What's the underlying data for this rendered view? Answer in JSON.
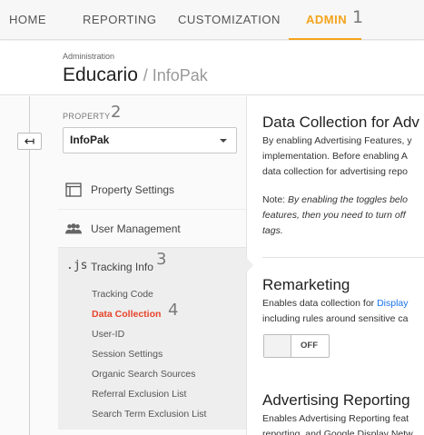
{
  "topnav": {
    "tabs": [
      {
        "label": "HOME"
      },
      {
        "label": "REPORTING"
      },
      {
        "label": "CUSTOMIZATION"
      },
      {
        "label": "ADMIN",
        "active": true
      }
    ],
    "active_color": "#f4a31b"
  },
  "annotations": [
    "1",
    "2",
    "3",
    "4"
  ],
  "header": {
    "breadcrumb": "Administration",
    "account": "Educario",
    "property_suffix": "/ InfoPak"
  },
  "back_button": {
    "icon": "back-arrow-icon",
    "glyph": "↤"
  },
  "property": {
    "label": "PROPERTY",
    "selected": "InfoPak"
  },
  "nav": {
    "property_settings": {
      "label": "Property Settings",
      "icon": "layout-icon"
    },
    "user_management": {
      "label": "User Management",
      "icon": "users-icon"
    },
    "tracking_info": {
      "label": "Tracking Info",
      "icon_text": ".js",
      "icon": "js-icon"
    },
    "sub_items": [
      {
        "label": "Tracking Code"
      },
      {
        "label": "Data Collection",
        "active": true
      },
      {
        "label": "User-ID"
      },
      {
        "label": "Session Settings"
      },
      {
        "label": "Organic Search Sources"
      },
      {
        "label": "Referral Exclusion List"
      },
      {
        "label": "Search Term Exclusion List"
      }
    ],
    "active_color": "#e8432b"
  },
  "content": {
    "title1": "Data Collection for Adv",
    "para1": [
      "By enabling Advertising Features, y",
      "implementation. Before enabling A",
      "data collection for advertising repo"
    ],
    "note_prefix": "Note: ",
    "note": [
      "By enabling the toggles belo",
      "features, then you need to turn off",
      "tags."
    ],
    "title2": "Remarketing",
    "para2_prefix": "Enables data collection for ",
    "para2_link": "Display",
    "para2_line2": "including rules around sensitive ca",
    "toggle_label": "OFF",
    "title3": "Advertising Reporting",
    "para3": [
      "Enables Advertising Reporting feat",
      "reporting, and Google Display Netw"
    ],
    "link_color": "#1a73e8"
  }
}
